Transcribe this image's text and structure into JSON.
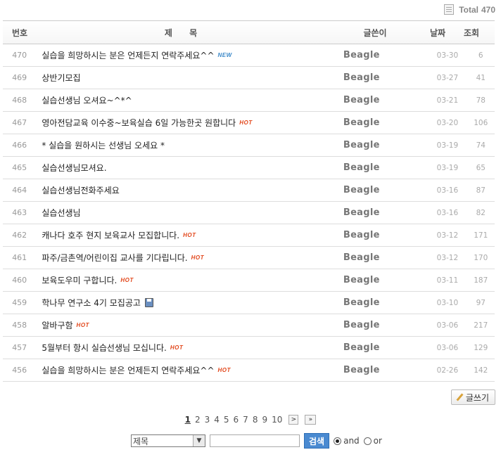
{
  "total": {
    "label": "Total",
    "count": "470"
  },
  "header": {
    "num": "번호",
    "title": "제  목",
    "author": "글쓴이",
    "date": "날짜",
    "views": "조회"
  },
  "rows": [
    {
      "num": "470",
      "title": "실습을 희망하시는 분은 언제든지 연락주세요^^",
      "badge": "NEW",
      "author": "Beagle",
      "date": "03-30",
      "views": "6"
    },
    {
      "num": "469",
      "title": "상반기모집",
      "badge": "",
      "author": "Beagle",
      "date": "03-27",
      "views": "41"
    },
    {
      "num": "468",
      "title": "실습선생님 오셔요~^*^",
      "badge": "",
      "author": "Beagle",
      "date": "03-21",
      "views": "78"
    },
    {
      "num": "467",
      "title": "영아전담교육 이수중~보육실습 6일 가능한곳 원합니다",
      "badge": "HOT",
      "author": "Beagle",
      "date": "03-20",
      "views": "106"
    },
    {
      "num": "466",
      "title": "* 실습을 원하시는 선생님 오세요 *",
      "badge": "",
      "author": "Beagle",
      "date": "03-19",
      "views": "74"
    },
    {
      "num": "465",
      "title": "실습선생님모셔요.",
      "badge": "",
      "author": "Beagle",
      "date": "03-19",
      "views": "65"
    },
    {
      "num": "464",
      "title": "실습선생님전화주세요",
      "badge": "",
      "author": "Beagle",
      "date": "03-16",
      "views": "87"
    },
    {
      "num": "463",
      "title": "실습선생님",
      "badge": "",
      "author": "Beagle",
      "date": "03-16",
      "views": "82"
    },
    {
      "num": "462",
      "title": "캐나다 호주 현지 보육교사 모집합니다.",
      "badge": "HOT",
      "author": "Beagle",
      "date": "03-12",
      "views": "171"
    },
    {
      "num": "461",
      "title": "파주/금촌역/어린이집 교사를 기다립니다.",
      "badge": "HOT",
      "author": "Beagle",
      "date": "03-12",
      "views": "170"
    },
    {
      "num": "460",
      "title": "보육도우미 구합니다.",
      "badge": "HOT",
      "author": "Beagle",
      "date": "03-11",
      "views": "187"
    },
    {
      "num": "459",
      "title": "학나무 연구소 4기 모집공고",
      "badge": "FILE",
      "author": "Beagle",
      "date": "03-10",
      "views": "97"
    },
    {
      "num": "458",
      "title": "알바구함",
      "badge": "HOT",
      "author": "Beagle",
      "date": "03-06",
      "views": "217"
    },
    {
      "num": "457",
      "title": "5월부터 항시 실습선생님 모십니다.",
      "badge": "HOT",
      "author": "Beagle",
      "date": "03-06",
      "views": "129"
    },
    {
      "num": "456",
      "title": "실습을 희망하시는 분은 언제든지 연락주세요^^",
      "badge": "HOT",
      "author": "Beagle",
      "date": "02-26",
      "views": "142"
    }
  ],
  "write_button": "글쓰기",
  "pager": {
    "pages": [
      "1",
      "2",
      "3",
      "4",
      "5",
      "6",
      "7",
      "8",
      "9",
      "10"
    ],
    "current": "1",
    "next": ">",
    "last": "»"
  },
  "search": {
    "field_selected": "제목",
    "button": "검색",
    "and_label": "and",
    "or_label": "or",
    "mode": "and"
  },
  "colors": {
    "hot": "#e2461a",
    "new": "#3c89c9",
    "search_button": "#4a8ad1"
  }
}
